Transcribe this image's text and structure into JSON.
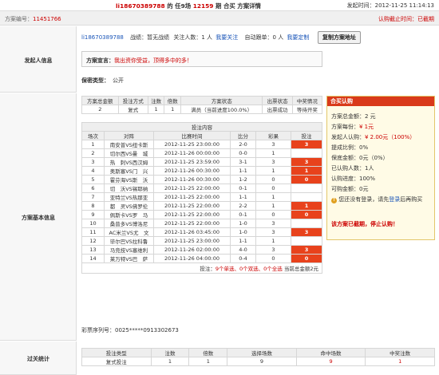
{
  "header": {
    "title_user": "li18670389788",
    "title_mid": " 的 任9场 ",
    "title_issue": "12159",
    "title_tail": " 期 合买 方案详情",
    "time_label": "发起时间：",
    "time_value": "2012-11-25 11:14:13"
  },
  "subbar": {
    "scheme_label": "方案编号：",
    "scheme_no": "11451766",
    "deadline": "认购截止时间：已截期"
  },
  "initiator": {
    "section_label": "发起人信息",
    "username": "li18670389788",
    "record_label": "战绩：",
    "record_value": "暂无战绩",
    "follow_label": "关注人数：",
    "follow_count": "1 人",
    "follow_link": "我要关注",
    "autofollow_label": "自动跟单：",
    "autofollow_count": "0 人",
    "custom_link": "我要定制",
    "copy_button": "复制方案地址",
    "declaration_label": "方案宣言：",
    "declaration_text": "我出资你受益，顶得多中的多！",
    "privacy_label": "保密类型：",
    "privacy_value": "公开"
  },
  "basic": {
    "section_label": "方案基本信息",
    "summary_headers": [
      "方案总金额",
      "投注方式",
      "注数",
      "倍数",
      "方案状态",
      "出票状态",
      "中奖情况"
    ],
    "summary_row": [
      "2",
      "复式",
      "1",
      "1",
      "满员（当前进度100.0%）",
      "出票成功",
      "等待开奖"
    ],
    "bet_title": "投注内容",
    "bet_headers": [
      "场次",
      "对阵",
      "比赛时间",
      "比分",
      "彩果",
      "投注"
    ],
    "matches": [
      {
        "no": "1",
        "match": "南安普VS纽卡斯",
        "time": "2012-11-25 23:00:00",
        "score": "2-0",
        "result": "3",
        "bet": "3",
        "hit": true
      },
      {
        "no": "2",
        "match": "切尔西VS曼　城",
        "time": "2012-11-26 00:00:00",
        "score": "0-0",
        "result": "1",
        "bet": "",
        "hit": false
      },
      {
        "no": "3",
        "match": "热　刺VS西汉姆",
        "time": "2012-11-25 23:59:00",
        "score": "3-1",
        "result": "3",
        "bet": "3",
        "hit": true
      },
      {
        "no": "4",
        "match": "奥斯塞VS门　兴",
        "time": "2012-11-26 00:30:00",
        "score": "1-1",
        "result": "1",
        "bet": "1",
        "hit": true
      },
      {
        "no": "5",
        "match": "霍芬海VS斯　沃",
        "time": "2012-11-26 00:30:00",
        "score": "1-2",
        "result": "0",
        "bet": "0",
        "hit": true
      },
      {
        "no": "6",
        "match": "切　沃VS锡耶纳",
        "time": "2012-11-25 22:00:00",
        "score": "0-1",
        "result": "0",
        "bet": "",
        "hit": false
      },
      {
        "no": "7",
        "match": "亚特兰VS热那亚",
        "time": "2012-11-25 22:00:00",
        "score": "1-1",
        "result": "1",
        "bet": "",
        "hit": false
      },
      {
        "no": "8",
        "match": "都　灵VS佛罗伦",
        "time": "2012-11-25 22:00:00",
        "score": "2-2",
        "result": "1",
        "bet": "1",
        "hit": true
      },
      {
        "no": "9",
        "match": "佩斯卡VS罗　马",
        "time": "2012-11-25 22:00:00",
        "score": "0-1",
        "result": "0",
        "bet": "0",
        "hit": true
      },
      {
        "no": "10",
        "match": "桑普多VS博洛尼",
        "time": "2012-11-25 22:00:00",
        "score": "1-0",
        "result": "3",
        "bet": "",
        "hit": false
      },
      {
        "no": "11",
        "match": "AC米兰VS尤　文",
        "time": "2012-11-26 03:45:00",
        "score": "1-0",
        "result": "3",
        "bet": "3",
        "hit": true
      },
      {
        "no": "12",
        "match": "毕尔巴VS拉科鲁",
        "time": "2012-11-25 23:00:00",
        "score": "1-1",
        "result": "1",
        "bet": "",
        "hit": false
      },
      {
        "no": "13",
        "match": "马竞技VS塞维利",
        "time": "2012-11-26 02:00:00",
        "score": "4-0",
        "result": "3",
        "bet": "3",
        "hit": true
      },
      {
        "no": "14",
        "match": "莱万特VS巴　萨",
        "time": "2012-11-26 04:00:00",
        "score": "0-4",
        "result": "0",
        "bet": "0",
        "hit": true
      }
    ],
    "bet_summary_prefix": "投注：",
    "bet_summary_single": "9个单选、",
    "bet_summary_double": "0个双选、",
    "bet_summary_all": "0个全选",
    "bet_summary_total": " 当前总金额2元",
    "serial_label": "彩票序列号：",
    "serial_value": "0025*****0913302673"
  },
  "panel": {
    "title": "合买认购",
    "total": "方案总金额：2 元",
    "per_share_label": "方案每份：",
    "per_share_value": "¥ 1元",
    "initiator_buy_label": "发起人认购：",
    "initiator_buy_value": "¥ 2.00元（100%）",
    "commission": "提成比例：0%",
    "guarantee": "保底金额：0元（0%）",
    "buyers": "已认购人数：1人",
    "progress": "认购进度：100%",
    "available": "可购金额：0元",
    "login_text": "您还没有登录，请先",
    "login_link": "登录",
    "login_tail": "后再购买",
    "closed_notice": "该方案已截期，停止认购！"
  },
  "pass_stats": {
    "section_label": "过关统计",
    "headers": [
      "投注类型",
      "注数",
      "倍数",
      "选择场数",
      "命中场数",
      "中奖注数"
    ],
    "row": [
      "复式投注",
      "1",
      "1",
      "9",
      "9",
      "1"
    ]
  }
}
